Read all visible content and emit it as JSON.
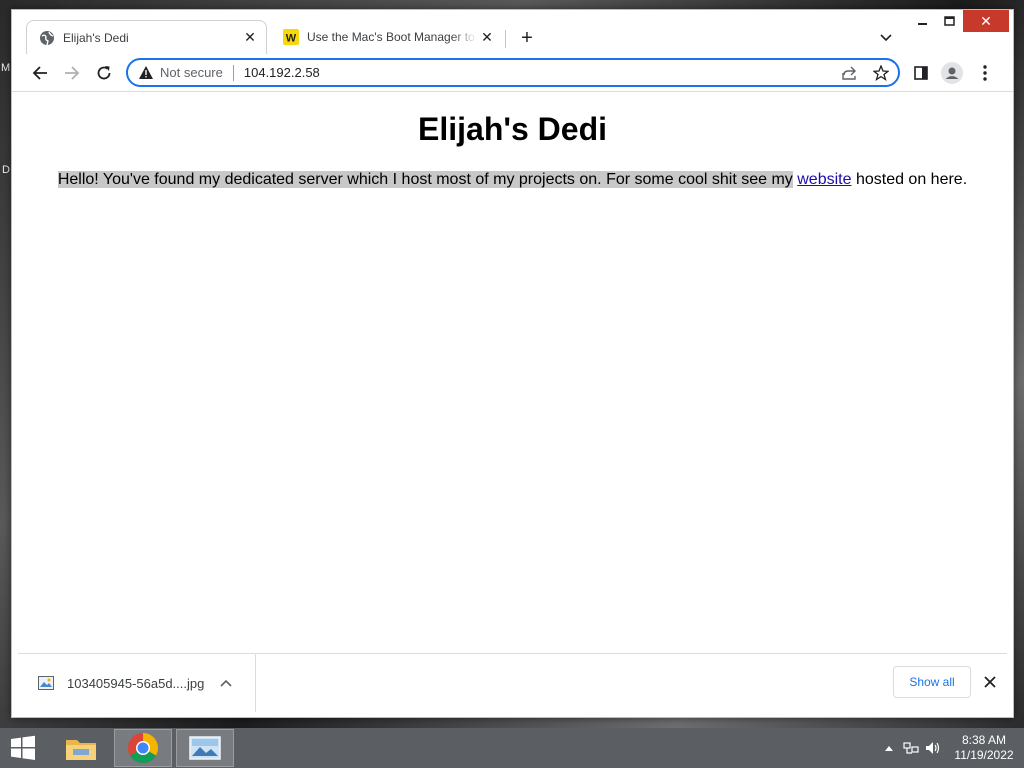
{
  "browser": {
    "tabs": [
      {
        "title": "Elijah's Dedi",
        "active": true
      },
      {
        "title": "Use the Mac's Boot Manager to b",
        "active": false
      }
    ],
    "address": {
      "security_label": "Not secure",
      "url": "104.192.2.58"
    }
  },
  "page": {
    "heading": "Elijah's Dedi",
    "paragraph_selected": "Hello! You've found my dedicated server which I host most of my projects on. For some cool shit see my",
    "link_text": "website",
    "paragraph_tail": " hosted on here."
  },
  "downloads": {
    "file_name": "103405945-56a5d....jpg",
    "show_all_label": "Show all"
  },
  "taskbar": {
    "time": "8:38 AM",
    "date": "11/19/2022"
  },
  "desktop": {
    "fragments": [
      "M",
      "D"
    ]
  },
  "colors": {
    "accent": "#1a73e8",
    "close_red": "#c7392b",
    "taskbar": "#5b5e63",
    "selection": "#c8c8c8",
    "link": "#1a0dab"
  }
}
